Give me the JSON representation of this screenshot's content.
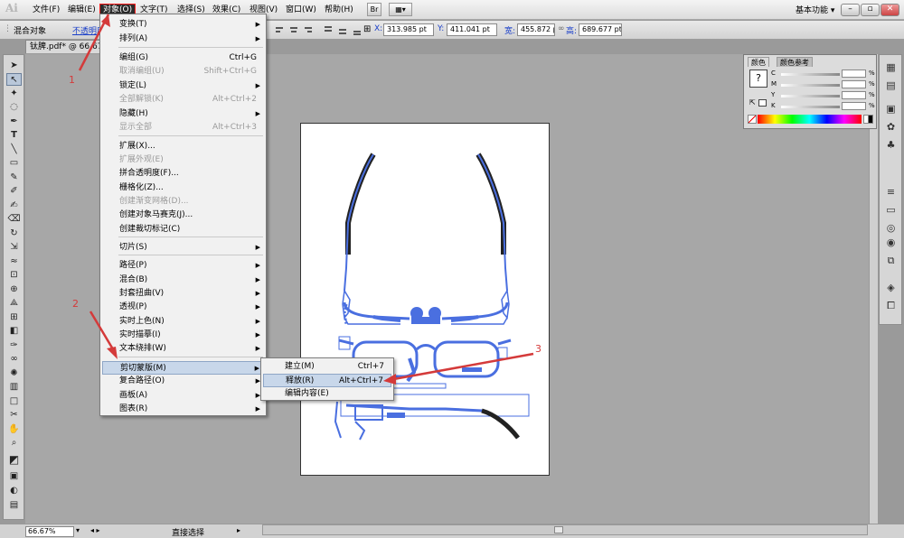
{
  "menubar": {
    "logo": "Ai",
    "items": [
      "文件(F)",
      "编辑(E)",
      "对象(O)",
      "文字(T)",
      "选择(S)",
      "效果(C)",
      "视图(V)",
      "窗口(W)",
      "帮助(H)"
    ],
    "icon1": "Br",
    "workspace": "基本功能"
  },
  "controlbar": {
    "selection": "混合对象",
    "opacity_link": "不透明度",
    "x_label": "X:",
    "x_value": "313.985 pt",
    "y_label": "Y:",
    "y_value": "411.041 pt",
    "w_label": "宽:",
    "w_value": "455.872 pt",
    "h_label": "高:",
    "h_value": "689.677 pt"
  },
  "document": {
    "tab": "钛脾.pdf* @ 66.67%"
  },
  "object_menu": {
    "items": [
      {
        "label": "变换(T)",
        "shortcut": "",
        "submenu": true,
        "disabled": false
      },
      {
        "label": "排列(A)",
        "shortcut": "",
        "submenu": true,
        "disabled": false
      },
      {
        "label": "编组(G)",
        "shortcut": "Ctrl+G",
        "submenu": false,
        "disabled": false
      },
      {
        "label": "取消编组(U)",
        "shortcut": "Shift+Ctrl+G",
        "submenu": false,
        "disabled": true
      },
      {
        "label": "锁定(L)",
        "shortcut": "",
        "submenu": true,
        "disabled": false
      },
      {
        "label": "全部解锁(K)",
        "shortcut": "Alt+Ctrl+2",
        "submenu": false,
        "disabled": true
      },
      {
        "label": "隐藏(H)",
        "shortcut": "",
        "submenu": true,
        "disabled": false
      },
      {
        "label": "显示全部",
        "shortcut": "Alt+Ctrl+3",
        "submenu": false,
        "disabled": true
      },
      {
        "label": "扩展(X)...",
        "shortcut": "",
        "submenu": false,
        "disabled": false
      },
      {
        "label": "扩展外观(E)",
        "shortcut": "",
        "submenu": false,
        "disabled": true
      },
      {
        "label": "拼合透明度(F)...",
        "shortcut": "",
        "submenu": false,
        "disabled": false
      },
      {
        "label": "栅格化(Z)...",
        "shortcut": "",
        "submenu": false,
        "disabled": false
      },
      {
        "label": "创建渐变网格(D)...",
        "shortcut": "",
        "submenu": false,
        "disabled": true
      },
      {
        "label": "创建对象马赛克(J)...",
        "shortcut": "",
        "submenu": false,
        "disabled": false
      },
      {
        "label": "创建裁切标记(C)",
        "shortcut": "",
        "submenu": false,
        "disabled": false
      },
      {
        "label": "切片(S)",
        "shortcut": "",
        "submenu": true,
        "disabled": false
      },
      {
        "label": "路径(P)",
        "shortcut": "",
        "submenu": true,
        "disabled": false
      },
      {
        "label": "混合(B)",
        "shortcut": "",
        "submenu": true,
        "disabled": false
      },
      {
        "label": "封套扭曲(V)",
        "shortcut": "",
        "submenu": true,
        "disabled": false
      },
      {
        "label": "透视(P)",
        "shortcut": "",
        "submenu": true,
        "disabled": false
      },
      {
        "label": "实时上色(N)",
        "shortcut": "",
        "submenu": true,
        "disabled": false
      },
      {
        "label": "实时描摹(I)",
        "shortcut": "",
        "submenu": true,
        "disabled": false
      },
      {
        "label": "文本绕排(W)",
        "shortcut": "",
        "submenu": true,
        "disabled": false
      },
      {
        "label": "剪切蒙版(M)",
        "shortcut": "",
        "submenu": true,
        "disabled": false
      },
      {
        "label": "复合路径(O)",
        "shortcut": "",
        "submenu": true,
        "disabled": false
      },
      {
        "label": "画板(A)",
        "shortcut": "",
        "submenu": true,
        "disabled": false
      },
      {
        "label": "图表(R)",
        "shortcut": "",
        "submenu": true,
        "disabled": false
      }
    ]
  },
  "clip_submenu": {
    "items": [
      {
        "label": "建立(M)",
        "shortcut": "Ctrl+7"
      },
      {
        "label": "释放(R)",
        "shortcut": "Alt+Ctrl+7"
      },
      {
        "label": "编辑内容(E)",
        "shortcut": ""
      }
    ]
  },
  "color_panel": {
    "tabs": [
      "颜色",
      "颜色参考"
    ],
    "channels": [
      "C",
      "M",
      "Y",
      "K"
    ],
    "unit": "%"
  },
  "statusbar": {
    "zoom": "66.67%",
    "tool": "直接选择"
  },
  "annotations": [
    "1",
    "2",
    "3"
  ],
  "colors": {
    "annotation_red": "#d43a3a",
    "path_blue": "#4a6fe0",
    "menu_highlight": "#c8d7ea"
  }
}
